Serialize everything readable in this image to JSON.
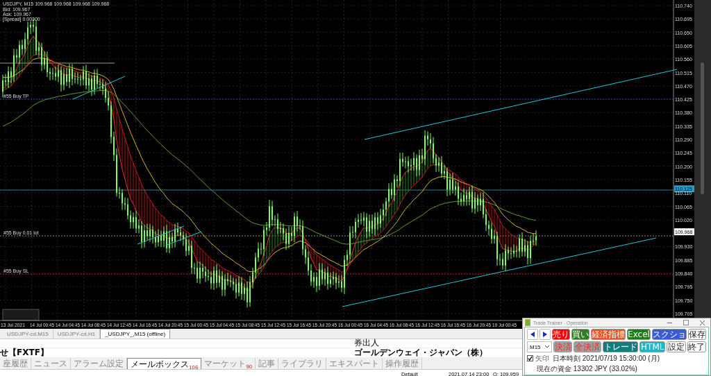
{
  "chart": {
    "legend": {
      "title": "USDJPY, M15  109.968 109.968 109.968 109.968",
      "lines": [
        "Bid: 109.967",
        "Ask: 109.967",
        "[Spread] 0.00300"
      ]
    },
    "order_lines": [
      {
        "text": "#55 Buy TP",
        "kind": "tp"
      },
      {
        "text": "#55 Buy 0.01 lot",
        "kind": "entry"
      },
      {
        "text": "#55 Buy SL",
        "kind": "sl"
      }
    ],
    "price_scale": [
      {
        "text": "110.740",
        "kind": "tick"
      },
      {
        "text": "110.695",
        "kind": "tick"
      },
      {
        "text": "110.650",
        "kind": "tick"
      },
      {
        "text": "110.605",
        "kind": "tick"
      },
      {
        "text": "110.560",
        "kind": "tick"
      },
      {
        "text": "110.515",
        "kind": "tick"
      },
      {
        "text": "110.470",
        "kind": "tick"
      },
      {
        "text": "110.425",
        "kind": "tick"
      },
      {
        "text": "110.380",
        "kind": "tick"
      },
      {
        "text": "110.335",
        "kind": "tick"
      },
      {
        "text": "110.290",
        "kind": "tick"
      },
      {
        "text": "110.245",
        "kind": "tick"
      },
      {
        "text": "110.200",
        "kind": "tick"
      },
      {
        "text": "110.155",
        "kind": "tick"
      },
      {
        "text": "110.125",
        "kind": "line_marker"
      },
      {
        "text": "110.110",
        "kind": "tick"
      },
      {
        "text": "110.065",
        "kind": "tick"
      },
      {
        "text": "110.020",
        "kind": "tick"
      },
      {
        "text": "109.968",
        "kind": "price_marker"
      },
      {
        "text": "109.930",
        "kind": "tick"
      },
      {
        "text": "109.885",
        "kind": "tick"
      },
      {
        "text": "109.840",
        "kind": "tick"
      },
      {
        "text": "109.795",
        "kind": "tick"
      },
      {
        "text": "109.750",
        "kind": "tick"
      },
      {
        "text": "109.705",
        "kind": "tick"
      }
    ],
    "time_scale": [
      "13 Jul 2021",
      "14 Jul 00:45",
      "14 Jul 04:45",
      "14 Jul 08:45",
      "14 Jul 12:45",
      "14 Jul 16:45",
      "14 Jul 20:45",
      "15 Jul 00:45",
      "15 Jul 04:45",
      "15 Jul 08:45",
      "15 Jul 12:45",
      "15 Jul 16:45",
      "15 Jul 20:45",
      "16 Jul 00:45",
      "16 Jul 04:45",
      "16 Jul 08:45",
      "16 Jul 12:45",
      "16 Jul 16:45",
      "16 Jul 20:45",
      "19 Jul 00:45"
    ]
  },
  "chart_tabs": [
    {
      "label": "USDJPY-cd,M15",
      "selected": false
    },
    {
      "label": "USDJPY-cd,H1",
      "selected": false
    },
    {
      "label": "_USDJPY_,M15 (offline)",
      "selected": true
    }
  ],
  "terminal": {
    "header_right": "券出人",
    "row_left": "せ【FXTF】",
    "row_right": "ゴールデンウェイ・ジャパン（株）",
    "tabs": [
      {
        "label": "座履歴",
        "selected": false
      },
      {
        "label": "ニュース",
        "selected": false
      },
      {
        "label": "アラーム設定",
        "selected": false
      },
      {
        "label": "メールボックス",
        "badge": "106",
        "selected": true
      },
      {
        "label": "マーケット",
        "badge": "90",
        "selected": false
      },
      {
        "label": "記事",
        "selected": false
      },
      {
        "label": "ライブラリ",
        "selected": false
      },
      {
        "label": "エキスパート",
        "selected": false
      },
      {
        "label": "操作履歴",
        "selected": false
      }
    ]
  },
  "status_bar": {
    "profile": "Default",
    "datetime": "2021.07.14 23:00",
    "open": "O: 109.959"
  },
  "trade_trainer": {
    "title": "Trade Trainer - Operation",
    "buttons_row_1": [
      {
        "label": "売り",
        "color": "#ff0000",
        "disabled": false
      },
      {
        "label": "買い",
        "color": "#2e7d1e",
        "disabled": false
      },
      {
        "label": "経済指標",
        "color": "#f0501e",
        "disabled": false
      },
      {
        "label": "Excel",
        "color": "#237a1a",
        "disabled": false
      },
      {
        "label": "スクショ",
        "color": "#3a5bd6",
        "disabled": false
      },
      {
        "label": "保存",
        "color": "#ffffff",
        "disabled": false
      }
    ],
    "timeframe": "M15",
    "buttons_row_2": [
      {
        "label": "決済",
        "color": "#a0a0a0",
        "disabled": true
      },
      {
        "label": "全決済",
        "color": "#a0a0a0",
        "disabled": true
      },
      {
        "label": "トレード",
        "color": "#137d7d",
        "disabled": false
      },
      {
        "label": "HTML",
        "color": "#22b5c8",
        "disabled": false
      },
      {
        "label": "設定",
        "color": "#ffffff",
        "disabled": false
      },
      {
        "label": "終了",
        "color": "#ffffff",
        "disabled": false
      }
    ],
    "arrow_checkbox": {
      "label": "矢印",
      "checked": true
    },
    "japan_time": "日本時刻 2021/07/19 15:30:00 (月)",
    "balance": "現在の資金 13302 JPY (33.02%)"
  }
}
